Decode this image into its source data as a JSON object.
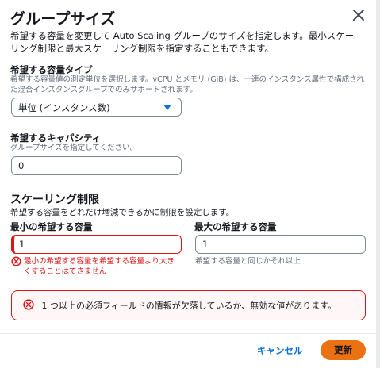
{
  "modal": {
    "title": "グループサイズ",
    "description": "希望する容量を変更して Auto Scaling グループのサイズを指定します。最小スケーリング制限と最大スケーリング制限を指定することもできます。"
  },
  "capacity_type": {
    "label": "希望する容量タイプ",
    "description": "希望する容量値の測定単位を選択します。vCPU とメモリ (GiB) は、一連のインスタンス属性で構成された混合インスタンスグループでのみサポートされます。",
    "selected": "単位 (インスタンス数)"
  },
  "desired_capacity": {
    "label": "希望するキャパシティ",
    "description": "グループサイズを指定してください。",
    "value": "0"
  },
  "scaling_limits": {
    "title": "スケーリング制限",
    "description": "希望する容量をどれだけ増減できるかに制限を設定します。",
    "min": {
      "label": "最小の希望する容量",
      "value": "1",
      "error": "最小の希望する容量を希望する容量より大きくすることはできません"
    },
    "max": {
      "label": "最大の希望する容量",
      "value": "1",
      "hint": "希望する容量と同じかそれ以上"
    }
  },
  "alert": {
    "message": "1 つ以上の必須フィールドの情報が欠落しているか、無効な値があります。"
  },
  "footer": {
    "cancel_label": "キャンセル",
    "update_label": "更新"
  },
  "colors": {
    "accent": "#0972d3",
    "error": "#d91515",
    "primary_button": "#ec7211"
  }
}
